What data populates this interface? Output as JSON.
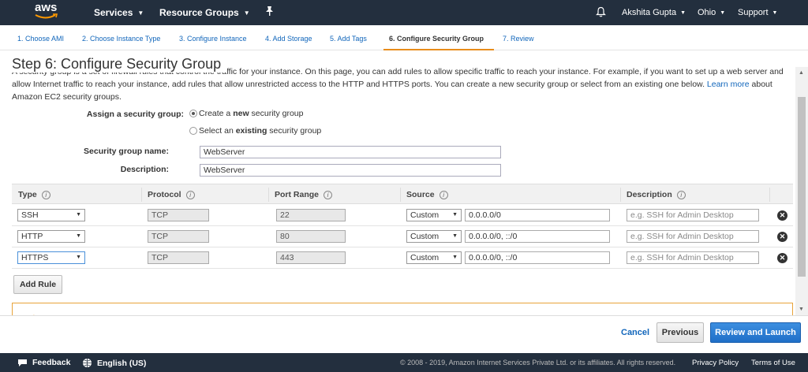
{
  "nav": {
    "logo_text": "aws",
    "services": "Services",
    "resource_groups": "Resource Groups",
    "user": "Akshita Gupta",
    "region": "Ohio",
    "support": "Support"
  },
  "tabs": [
    {
      "label": "1. Choose AMI"
    },
    {
      "label": "2. Choose Instance Type"
    },
    {
      "label": "3. Configure Instance"
    },
    {
      "label": "4. Add Storage"
    },
    {
      "label": "5. Add Tags"
    },
    {
      "label": "6. Configure Security Group"
    },
    {
      "label": "7. Review"
    }
  ],
  "page": {
    "title": "Step 6: Configure Security Group",
    "desc_line1": "A security group is a set of firewall rules that control the traffic for your instance. On this page, you can add rules to allow specific traffic to reach your instance. For example, if you want to set up a web server and",
    "desc_line2_pre": "allow Internet traffic to reach your instance, add rules that allow unrestricted access to the HTTP and HTTPS ports. You can create a new security group or select from an existing one below.",
    "learn_more": "Learn more",
    "desc_line2_post": "about",
    "desc_line3": "Amazon EC2 security groups."
  },
  "form": {
    "assign_label": "Assign a security group:",
    "option_new_pre": "Create a ",
    "option_new_bold": "new",
    "option_new_post": " security group",
    "option_existing_pre": "Select an ",
    "option_existing_bold": "existing",
    "option_existing_post": " security group",
    "name_label": "Security group name:",
    "name_value": "WebServer",
    "desc_label": "Description:",
    "desc_value": "WebServer"
  },
  "table": {
    "headers": {
      "type": "Type",
      "protocol": "Protocol",
      "port_range": "Port Range",
      "source": "Source",
      "description": "Description"
    },
    "info_glyph": "i",
    "rows": [
      {
        "type": "SSH",
        "protocol": "TCP",
        "port": "22",
        "source_mode": "Custom",
        "source": "0.0.0.0/0",
        "desc_placeholder": "e.g. SSH for Admin Desktop"
      },
      {
        "type": "HTTP",
        "protocol": "TCP",
        "port": "80",
        "source_mode": "Custom",
        "source": "0.0.0.0/0, ::/0",
        "desc_placeholder": "e.g. SSH for Admin Desktop"
      },
      {
        "type": "HTTPS",
        "protocol": "TCP",
        "port": "443",
        "source_mode": "Custom",
        "source": "0.0.0.0/0, ::/0",
        "desc_placeholder": "e.g. SSH for Admin Desktop"
      }
    ],
    "add_rule": "Add Rule"
  },
  "actions": {
    "cancel": "Cancel",
    "previous": "Previous",
    "review_launch": "Review and Launch"
  },
  "footer": {
    "feedback": "Feedback",
    "language": "English (US)",
    "copyright": "© 2008 - 2019, Amazon Internet Services Private Ltd. or its affiliates. All rights reserved.",
    "privacy": "Privacy Policy",
    "terms": "Terms of Use"
  },
  "colors": {
    "nav_bg": "#232f3e",
    "link": "#1166bb",
    "active_tab_underline": "#e88c1a",
    "primary_button": "#1f6fc8",
    "warning_border": "#e8a33a"
  }
}
